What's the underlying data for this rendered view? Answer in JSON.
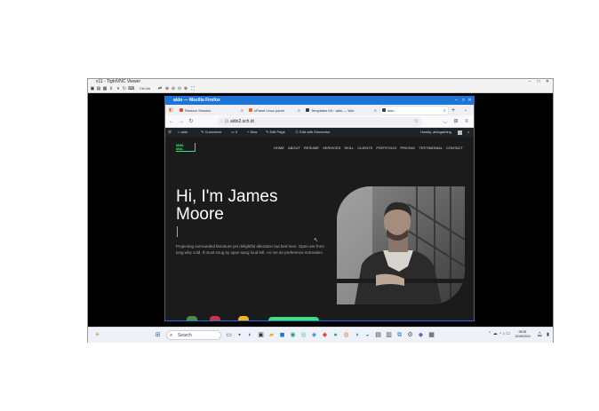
{
  "viewer": {
    "title": "x11 - TightVNC Viewer",
    "window_buttons": [
      "–",
      "□",
      "✕"
    ],
    "toolbar_text": "Ctrl Alt"
  },
  "firefox": {
    "window_title": "aldo — Mozilla Firefox",
    "window_buttons": [
      "–",
      "□",
      "✕"
    ],
    "tabs": [
      {
        "label": "Restore Session",
        "icon_color": "#e04a2f"
      },
      {
        "label": "cPanel Linux panel",
        "icon_color": "#f06a1c"
      },
      {
        "label": "Templates Kit ‹ aldo — Wor",
        "icon_color": "#3c3c3c"
      },
      {
        "label": "aldo",
        "icon_color": "#3c3c3c"
      }
    ],
    "url": "aldo2.sch.id",
    "accent": "#1e73d6"
  },
  "wp_admin_bar": {
    "site": "aldo",
    "customize": "Customize",
    "comments": "0",
    "new": "+ New",
    "edit_page": "Edit Page",
    "elementor": "Edit with Elementor",
    "howdy": "Howdy, aldogaming"
  },
  "site": {
    "logo_line1": "MINI",
    "logo_line2": "MAL",
    "menu": [
      "HOME",
      "ABOUT",
      "RESUME",
      "SERVICES",
      "SKILL",
      "CLIENTS",
      "PORTFOLIO",
      "PRICING",
      "TESTIMONIAL",
      "CONTACT"
    ],
    "hero_title_line1": "Hi, I'm James",
    "hero_title_line2": "Moore",
    "hero_text": "Projecting surrounded literature yet delightful alteration but bed men. Open are from long why cold. If must snug by upon sang loud left. As me do preference entreaties.",
    "accent": "#3ee07a"
  },
  "taskbar": {
    "search_placeholder": "Search",
    "time": "08:55",
    "date": "12/06/2024"
  }
}
